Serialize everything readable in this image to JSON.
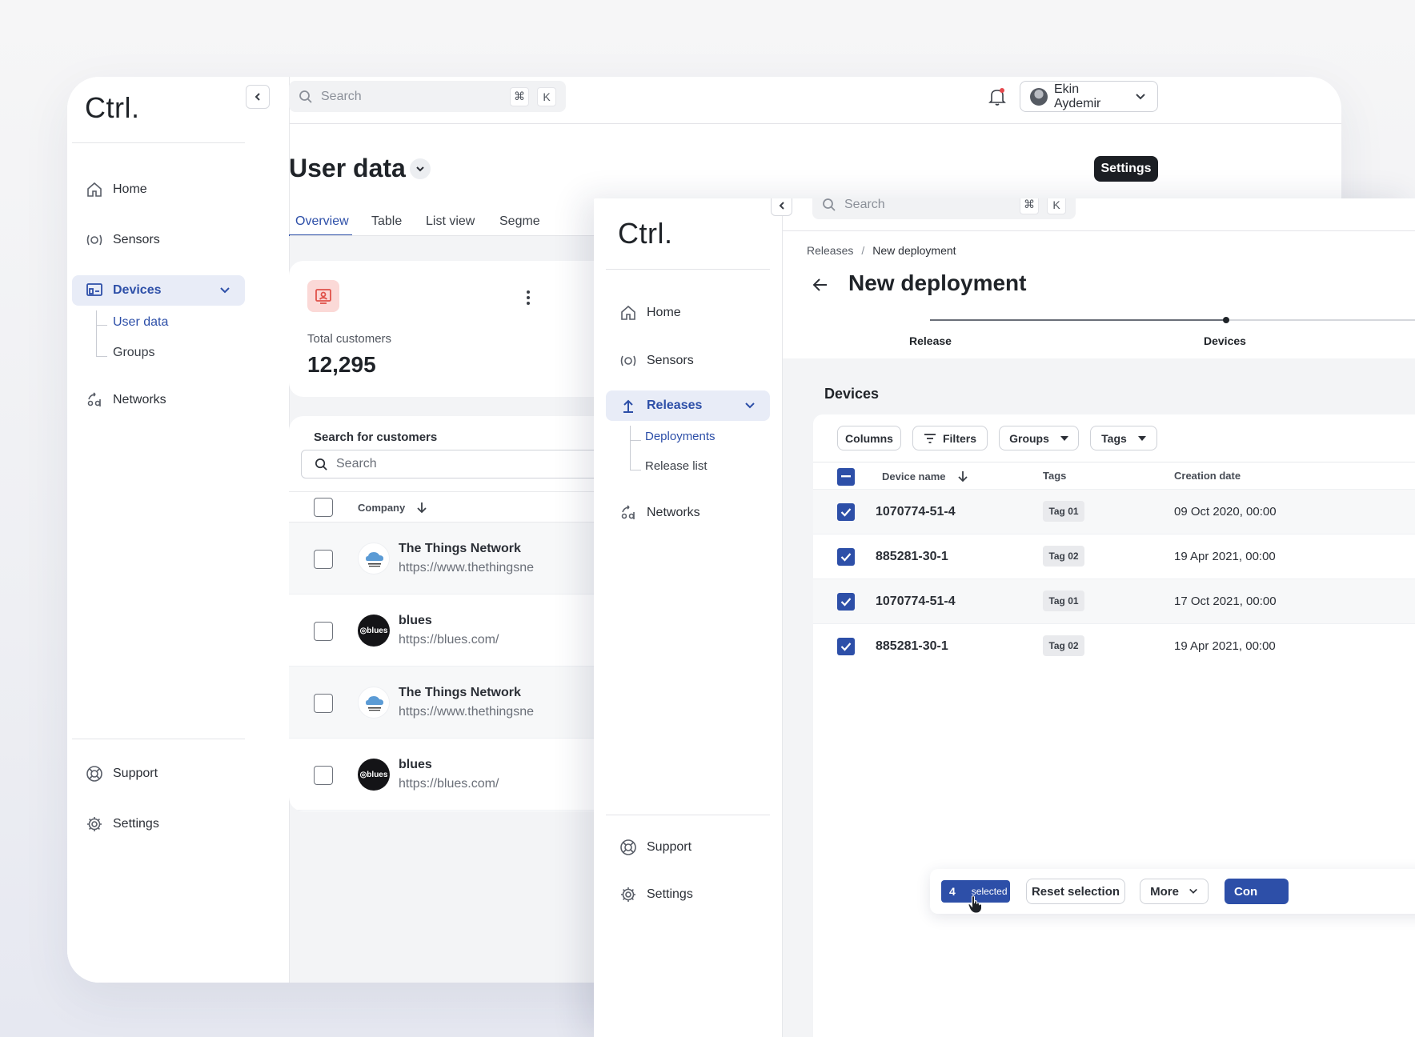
{
  "back_window": {
    "logo": "Ctrl.",
    "search": {
      "placeholder": "Search",
      "kbd1": "⌘",
      "kbd2": "K"
    },
    "user": {
      "name": "Ekin Aydemir"
    },
    "nav": {
      "home": "Home",
      "sensors": "Sensors",
      "devices": "Devices",
      "user_data": "User data",
      "groups": "Groups",
      "networks": "Networks",
      "support": "Support",
      "settings": "Settings"
    },
    "page": {
      "title": "User data",
      "settings_button": "Settings",
      "tabs": [
        "Overview",
        "Table",
        "List view",
        "Segme"
      ]
    },
    "stat": {
      "label": "Total customers",
      "value": "12,295"
    },
    "customers": {
      "search_label": "Search for customers",
      "search_placeholder": "Search",
      "column_company": "Company",
      "rows": [
        {
          "name": "The Things Network",
          "url": "https://www.thethingsne",
          "logo": "ttn"
        },
        {
          "name": "blues",
          "url": "https://blues.com/",
          "logo": "blues"
        },
        {
          "name": "The Things Network",
          "url": "https://www.thethingsne",
          "logo": "ttn"
        },
        {
          "name": "blues",
          "url": "https://blues.com/",
          "logo": "blues"
        }
      ],
      "blues_logo_text": "◎blues"
    }
  },
  "front_window": {
    "logo": "Ctrl.",
    "search": {
      "placeholder": "Search",
      "kbd1": "⌘",
      "kbd2": "K"
    },
    "nav": {
      "home": "Home",
      "sensors": "Sensors",
      "releases": "Releases",
      "deployments": "Deployments",
      "release_list": "Release list",
      "networks": "Networks",
      "support": "Support",
      "settings": "Settings"
    },
    "breadcrumb": {
      "parent": "Releases",
      "sep": "/",
      "current": "New deployment"
    },
    "title": "New deployment",
    "steps": [
      "Release",
      "Devices"
    ],
    "section_title": "Devices",
    "toolbar": {
      "columns": "Columns",
      "filters": "Filters",
      "groups": "Groups",
      "tags": "Tags"
    },
    "table": {
      "headers": {
        "device_name": "Device name",
        "tags": "Tags",
        "creation_date": "Creation date"
      },
      "rows": [
        {
          "device": "1070774-51-4",
          "tag": "Tag 01",
          "date": "09 Oct 2020, 00:00"
        },
        {
          "device": "885281-30-1",
          "tag": "Tag 02",
          "date": "19 Apr 2021, 00:00"
        },
        {
          "device": "1070774-51-4",
          "tag": "Tag 01",
          "date": "17 Oct 2021, 00:00"
        },
        {
          "device": "885281-30-1",
          "tag": "Tag 02",
          "date": "19 Apr 2021, 00:00"
        }
      ]
    },
    "selection_bar": {
      "count": "4",
      "count_label": "selected",
      "reset": "Reset selection",
      "more": "More",
      "confirm": "Con"
    }
  },
  "colors": {
    "accent": "#2d4fa8",
    "dark_button": "#1c1f24",
    "stat_icon_bg": "#fbd9d7",
    "stat_icon": "#e0524a"
  }
}
